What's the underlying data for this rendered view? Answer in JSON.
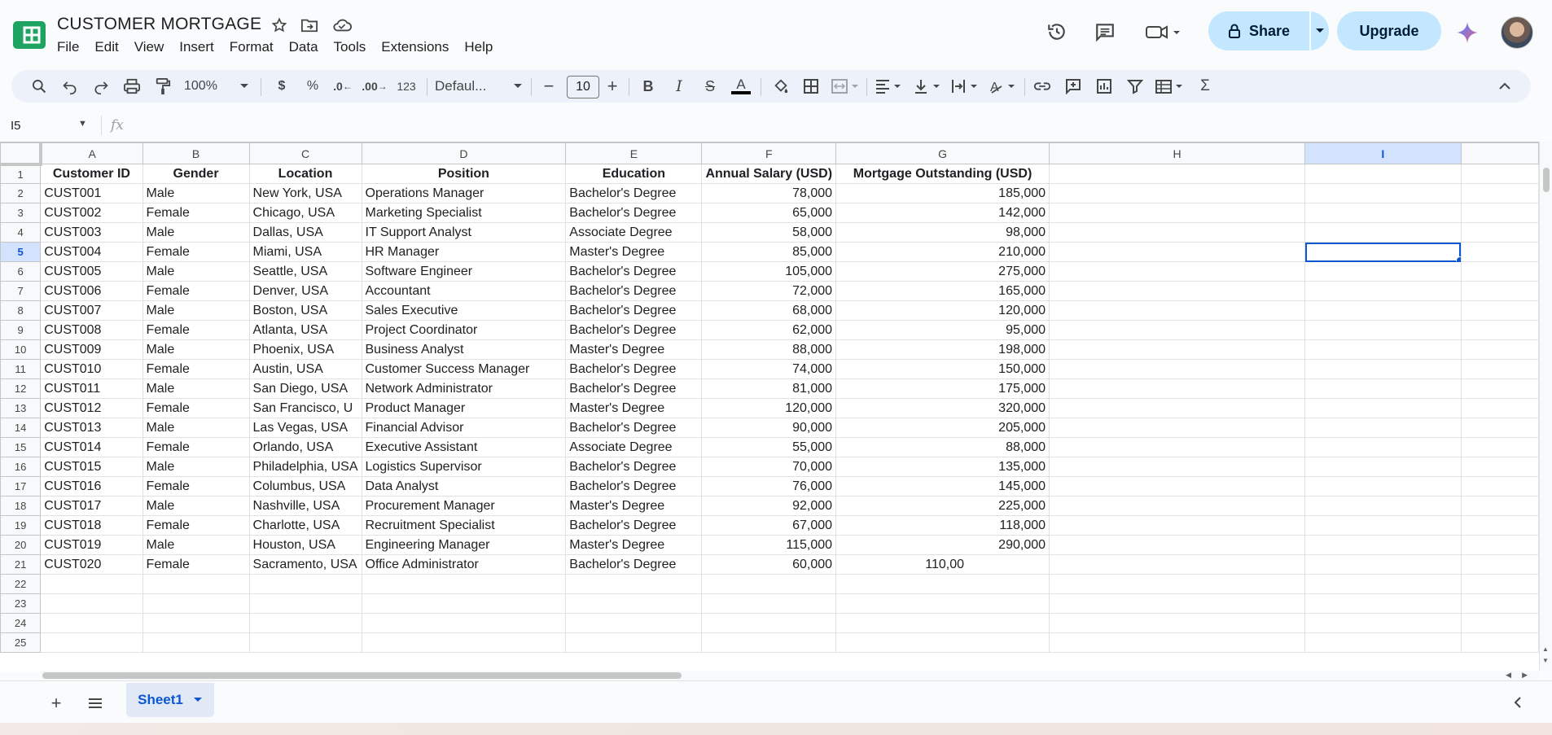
{
  "doc": {
    "title": "CUSTOMER MORTGAGE"
  },
  "menu": [
    "File",
    "Edit",
    "View",
    "Insert",
    "Format",
    "Data",
    "Tools",
    "Extensions",
    "Help"
  ],
  "header": {
    "share_label": "Share",
    "upgrade_label": "Upgrade"
  },
  "toolbar": {
    "zoom": "100%",
    "currency": "$",
    "percent": "%",
    "dec_decrease": ".0",
    "dec_increase": ".00",
    "number_format": "123",
    "font": "Defaul...",
    "font_size": "10",
    "sigma": "Σ"
  },
  "formula_bar": {
    "cell_ref": "I5",
    "fx": "fx",
    "value": ""
  },
  "sheet": {
    "columns": [
      "A",
      "B",
      "C",
      "D",
      "E",
      "F",
      "G",
      "H",
      "I",
      ""
    ],
    "selected_column": "I",
    "selected_row": 5,
    "headers": [
      "Customer ID",
      "Gender",
      "Location",
      "Position",
      "Education",
      "Annual Salary (USD)",
      "Mortgage Outstanding (USD)"
    ],
    "rows": [
      [
        "CUST001",
        "Male",
        "New York, USA",
        "Operations Manager",
        "Bachelor's Degree",
        "78,000",
        "185,000"
      ],
      [
        "CUST002",
        "Female",
        "Chicago, USA",
        "Marketing Specialist",
        "Bachelor's Degree",
        "65,000",
        "142,000"
      ],
      [
        "CUST003",
        "Male",
        "Dallas, USA",
        "IT Support Analyst",
        "Associate Degree",
        "58,000",
        "98,000"
      ],
      [
        "CUST004",
        "Female",
        "Miami, USA",
        "HR Manager",
        "Master's Degree",
        "85,000",
        "210,000"
      ],
      [
        "CUST005",
        "Male",
        "Seattle, USA",
        "Software Engineer",
        "Bachelor's Degree",
        "105,000",
        "275,000"
      ],
      [
        "CUST006",
        "Female",
        "Denver, USA",
        "Accountant",
        "Bachelor's Degree",
        "72,000",
        "165,000"
      ],
      [
        "CUST007",
        "Male",
        "Boston, USA",
        "Sales Executive",
        "Bachelor's Degree",
        "68,000",
        "120,000"
      ],
      [
        "CUST008",
        "Female",
        "Atlanta, USA",
        "Project Coordinator",
        "Bachelor's Degree",
        "62,000",
        "95,000"
      ],
      [
        "CUST009",
        "Male",
        "Phoenix, USA",
        "Business Analyst",
        "Master's Degree",
        "88,000",
        "198,000"
      ],
      [
        "CUST010",
        "Female",
        "Austin, USA",
        "Customer Success Manager",
        "Bachelor's Degree",
        "74,000",
        "150,000"
      ],
      [
        "CUST011",
        "Male",
        "San Diego, USA",
        "Network Administrator",
        "Bachelor's Degree",
        "81,000",
        "175,000"
      ],
      [
        "CUST012",
        "Female",
        "San Francisco, U",
        "Product Manager",
        "Master's Degree",
        "120,000",
        "320,000"
      ],
      [
        "CUST013",
        "Male",
        "Las Vegas, USA",
        "Financial Advisor",
        "Bachelor's Degree",
        "90,000",
        "205,000"
      ],
      [
        "CUST014",
        "Female",
        "Orlando, USA",
        "Executive Assistant",
        "Associate Degree",
        "55,000",
        "88,000"
      ],
      [
        "CUST015",
        "Male",
        "Philadelphia, USA",
        "Logistics Supervisor",
        "Bachelor's Degree",
        "70,000",
        "135,000"
      ],
      [
        "CUST016",
        "Female",
        "Columbus, USA",
        "Data Analyst",
        "Bachelor's Degree",
        "76,000",
        "145,000"
      ],
      [
        "CUST017",
        "Male",
        "Nashville, USA",
        "Procurement Manager",
        "Master's Degree",
        "92,000",
        "225,000"
      ],
      [
        "CUST018",
        "Female",
        "Charlotte, USA",
        "Recruitment Specialist",
        "Bachelor's Degree",
        "67,000",
        "118,000"
      ],
      [
        "CUST019",
        "Male",
        "Houston, USA",
        "Engineering Manager",
        "Master's Degree",
        "115,000",
        "290,000"
      ],
      [
        "CUST020",
        "Female",
        "Sacramento, USA",
        "Office Administrator",
        "Bachelor's Degree",
        "60,000",
        "110,00"
      ]
    ],
    "row_numbers": [
      "1",
      "2",
      "3",
      "4",
      "5",
      "6",
      "7",
      "8",
      "9",
      "10",
      "11",
      "12",
      "13",
      "14",
      "15",
      "16",
      "17",
      "18",
      "19",
      "20",
      "21",
      "22",
      "23",
      "24",
      "25"
    ]
  },
  "tabs": {
    "active": "Sheet1"
  },
  "colors": {
    "accent": "#0b57d0",
    "share_bg": "#c2e7ff",
    "selected_header": "#d3e3fd"
  }
}
